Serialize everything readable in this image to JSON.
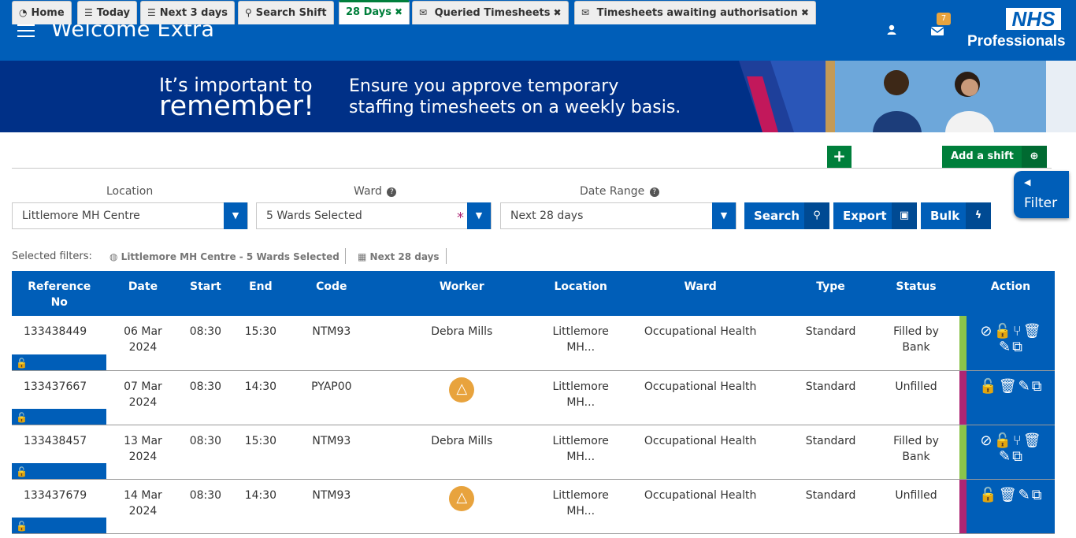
{
  "header": {
    "title": "Welcome Extra",
    "notification_count": "7",
    "logo_text": "NHS",
    "logo_sub": "Professionals"
  },
  "banner": {
    "line1": "It’s important to",
    "line2": "remember!",
    "msg1": "Ensure you approve temporary",
    "msg2": "staffing timesheets on a weekly basis."
  },
  "tabs": [
    {
      "label": "Home",
      "icon": "dashboard-icon"
    },
    {
      "label": "Today",
      "icon": "list-icon"
    },
    {
      "label": "Next 3 days",
      "icon": "list-icon"
    },
    {
      "label": "Search Shift",
      "icon": "search-icon"
    },
    {
      "label": "28 Days",
      "icon": "",
      "active": true
    },
    {
      "label": "Queried Timesheets",
      "icon": "envelope-icon"
    },
    {
      "label": "Timesheets awaiting authorisation",
      "icon": "envelope-icon"
    }
  ],
  "add_shift_label": "Add a shift",
  "filter_label": "Filter",
  "filters": {
    "location_label": "Location",
    "location_value": "Littlemore MH Centre",
    "ward_label": "Ward",
    "ward_value": "5 Wards Selected",
    "date_label": "Date Range",
    "date_value": "Next 28 days"
  },
  "buttons": {
    "search": "Search",
    "export": "Export",
    "bulk": "Bulk"
  },
  "selected_filters": {
    "label": "Selected filters:",
    "chip1": "Littlemore MH Centre - 5 Wards Selected",
    "chip2": "Next 28 days"
  },
  "table": {
    "headers": {
      "ref_a": "Reference",
      "ref_b": "No",
      "date": "Date",
      "start": "Start",
      "end": "End",
      "code": "Code",
      "worker": "Worker",
      "location": "Location",
      "ward": "Ward",
      "type": "Type",
      "status": "Status",
      "action": "Action"
    },
    "rows": [
      {
        "ref": "133438449",
        "date_a": "06 Mar",
        "date_b": "2024",
        "start": "08:30",
        "end": "15:30",
        "code": "NTM93",
        "worker": "Debra Mills",
        "loc_a": "Littlemore",
        "loc_b": "MH...",
        "ward": "Occupational Health",
        "type": "Standard",
        "status_a": "Filled by",
        "status_b": "Bank",
        "strip": "#8bc34a"
      },
      {
        "ref": "133437667",
        "date_a": "07 Mar",
        "date_b": "2024",
        "start": "08:30",
        "end": "14:30",
        "code": "PYAP00",
        "worker": "",
        "loc_a": "Littlemore",
        "loc_b": "MH...",
        "ward": "Occupational Health",
        "type": "Standard",
        "status_a": "Unfilled",
        "status_b": "",
        "strip": "#ae2573"
      },
      {
        "ref": "133438457",
        "date_a": "13 Mar",
        "date_b": "2024",
        "start": "08:30",
        "end": "15:30",
        "code": "NTM93",
        "worker": "Debra Mills",
        "loc_a": "Littlemore",
        "loc_b": "MH...",
        "ward": "Occupational Health",
        "type": "Standard",
        "status_a": "Filled by",
        "status_b": "Bank",
        "strip": "#8bc34a"
      },
      {
        "ref": "133437679",
        "date_a": "14 Mar",
        "date_b": "2024",
        "start": "08:30",
        "end": "14:30",
        "code": "NTM93",
        "worker": "",
        "loc_a": "Littlemore",
        "loc_b": "MH...",
        "ward": "Occupational Health",
        "type": "Standard",
        "status_a": "Unfilled",
        "status_b": "",
        "strip": "#ae2573"
      }
    ]
  },
  "colors": {
    "primary": "#005eb8",
    "banner": "#003087",
    "green": "#007f3b",
    "filled": "#8bc34a",
    "unfilled": "#ae2573",
    "warning": "#e8a33d"
  }
}
